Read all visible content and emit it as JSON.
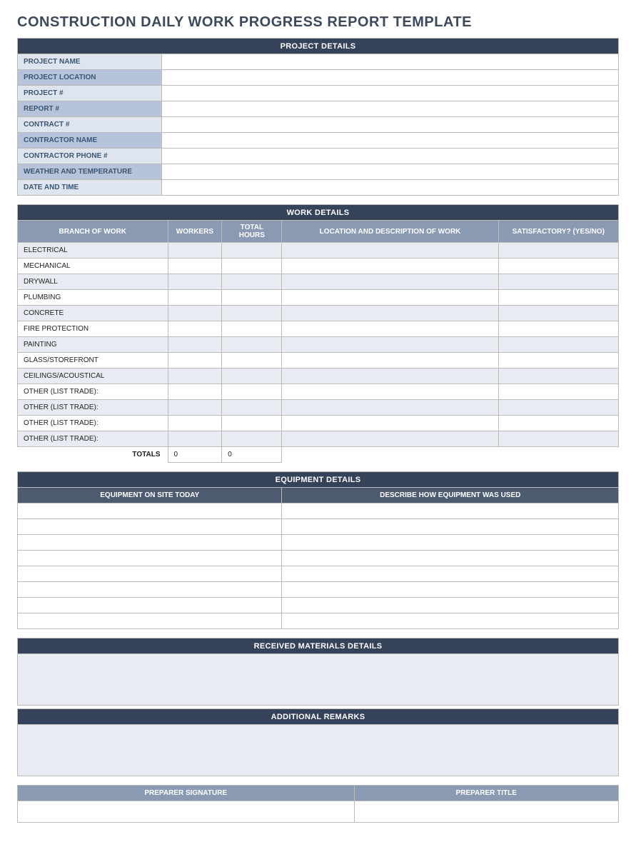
{
  "title": "CONSTRUCTION DAILY WORK PROGRESS REPORT TEMPLATE",
  "project_details": {
    "header": "PROJECT DETAILS",
    "rows": [
      {
        "label": "PROJECT NAME",
        "value": ""
      },
      {
        "label": "PROJECT LOCATION",
        "value": ""
      },
      {
        "label": "PROJECT #",
        "value": ""
      },
      {
        "label": "REPORT #",
        "value": ""
      },
      {
        "label": "CONTRACT #",
        "value": ""
      },
      {
        "label": "CONTRACTOR NAME",
        "value": ""
      },
      {
        "label": "CONTRACTOR PHONE #",
        "value": ""
      },
      {
        "label": "WEATHER AND TEMPERATURE",
        "value": ""
      },
      {
        "label": "DATE AND TIME",
        "value": ""
      }
    ]
  },
  "work_details": {
    "header": "WORK DETAILS",
    "columns": {
      "branch": "BRANCH OF WORK",
      "workers": "WORKERS",
      "hours": "TOTAL HOURS",
      "location": "LOCATION AND DESCRIPTION OF WORK",
      "satisfactory": "SATISFACTORY? (YES/NO)"
    },
    "rows": [
      {
        "branch": "ELECTRICAL",
        "workers": "",
        "hours": "",
        "location": "",
        "satisfactory": ""
      },
      {
        "branch": "MECHANICAL",
        "workers": "",
        "hours": "",
        "location": "",
        "satisfactory": ""
      },
      {
        "branch": "DRYWALL",
        "workers": "",
        "hours": "",
        "location": "",
        "satisfactory": ""
      },
      {
        "branch": "PLUMBING",
        "workers": "",
        "hours": "",
        "location": "",
        "satisfactory": ""
      },
      {
        "branch": "CONCRETE",
        "workers": "",
        "hours": "",
        "location": "",
        "satisfactory": ""
      },
      {
        "branch": "FIRE PROTECTION",
        "workers": "",
        "hours": "",
        "location": "",
        "satisfactory": ""
      },
      {
        "branch": "PAINTING",
        "workers": "",
        "hours": "",
        "location": "",
        "satisfactory": ""
      },
      {
        "branch": "GLASS/STOREFRONT",
        "workers": "",
        "hours": "",
        "location": "",
        "satisfactory": ""
      },
      {
        "branch": "CEILINGS/ACOUSTICAL",
        "workers": "",
        "hours": "",
        "location": "",
        "satisfactory": ""
      },
      {
        "branch": "OTHER (LIST TRADE):",
        "workers": "",
        "hours": "",
        "location": "",
        "satisfactory": ""
      },
      {
        "branch": "OTHER (LIST TRADE):",
        "workers": "",
        "hours": "",
        "location": "",
        "satisfactory": ""
      },
      {
        "branch": "OTHER (LIST TRADE):",
        "workers": "",
        "hours": "",
        "location": "",
        "satisfactory": ""
      },
      {
        "branch": "OTHER (LIST TRADE):",
        "workers": "",
        "hours": "",
        "location": "",
        "satisfactory": ""
      }
    ],
    "totals_label": "TOTALS",
    "totals_workers": "0",
    "totals_hours": "0"
  },
  "equipment_details": {
    "header": "EQUIPMENT DETAILS",
    "columns": {
      "onsite": "EQUIPMENT ON SITE TODAY",
      "usage": "DESCRIBE HOW EQUIPMENT WAS USED"
    },
    "rows": [
      {
        "onsite": "",
        "usage": ""
      },
      {
        "onsite": "",
        "usage": ""
      },
      {
        "onsite": "",
        "usage": ""
      },
      {
        "onsite": "",
        "usage": ""
      },
      {
        "onsite": "",
        "usage": ""
      },
      {
        "onsite": "",
        "usage": ""
      },
      {
        "onsite": "",
        "usage": ""
      },
      {
        "onsite": "",
        "usage": ""
      }
    ]
  },
  "received_materials": {
    "header": "RECEIVED MATERIALS DETAILS",
    "value": ""
  },
  "additional_remarks": {
    "header": "ADDITIONAL REMARKS",
    "value": ""
  },
  "preparer": {
    "signature_label": "PREPARER SIGNATURE",
    "title_label": "PREPARER TITLE",
    "signature_value": "",
    "title_value": ""
  }
}
